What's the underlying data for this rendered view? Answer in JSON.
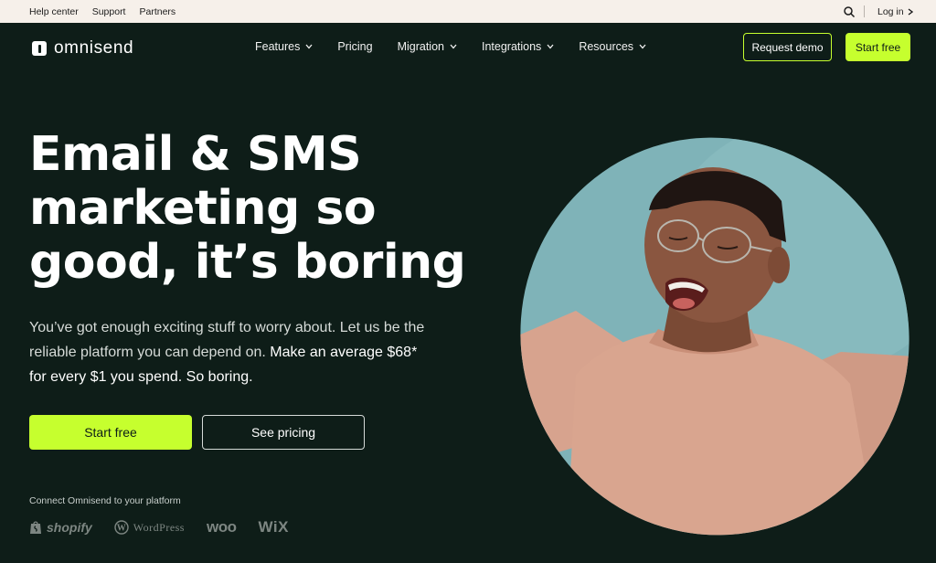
{
  "utility": {
    "links": [
      "Help center",
      "Support",
      "Partners"
    ],
    "login": "Log in"
  },
  "nav": {
    "brand": "omnisend",
    "menu": [
      {
        "label": "Features",
        "dropdown": true
      },
      {
        "label": "Pricing",
        "dropdown": false
      },
      {
        "label": "Migration",
        "dropdown": true
      },
      {
        "label": "Integrations",
        "dropdown": true
      },
      {
        "label": "Resources",
        "dropdown": true
      }
    ],
    "request_demo": "Request demo",
    "start_free": "Start free"
  },
  "hero": {
    "headline_line1": "Email & SMS",
    "headline_line2": "marketing so",
    "headline_line3": "good, it’s boring",
    "sub_part1": "You’ve got enough exciting stuff to worry about. Let us be the reliable platform you can depend on.",
    "sub_part2": "Make an average $68* for every $1 you spend. So boring.",
    "cta_primary": "Start free",
    "cta_secondary": "See pricing",
    "connect_label": "Connect Omnisend to your platform",
    "platforms": [
      "shopify",
      "WordPress",
      "woo",
      "WiX"
    ]
  },
  "colors": {
    "background": "#0e1d18",
    "accent": "#c6ff2e",
    "utility_bar": "#f6f0ea",
    "image_backdrop": "#7fb3b8",
    "sweater": "#d9a58f"
  },
  "icons": {
    "search": "search-icon",
    "chevron": "chevron-down-icon",
    "login_arrow": "chevron-right-icon"
  }
}
